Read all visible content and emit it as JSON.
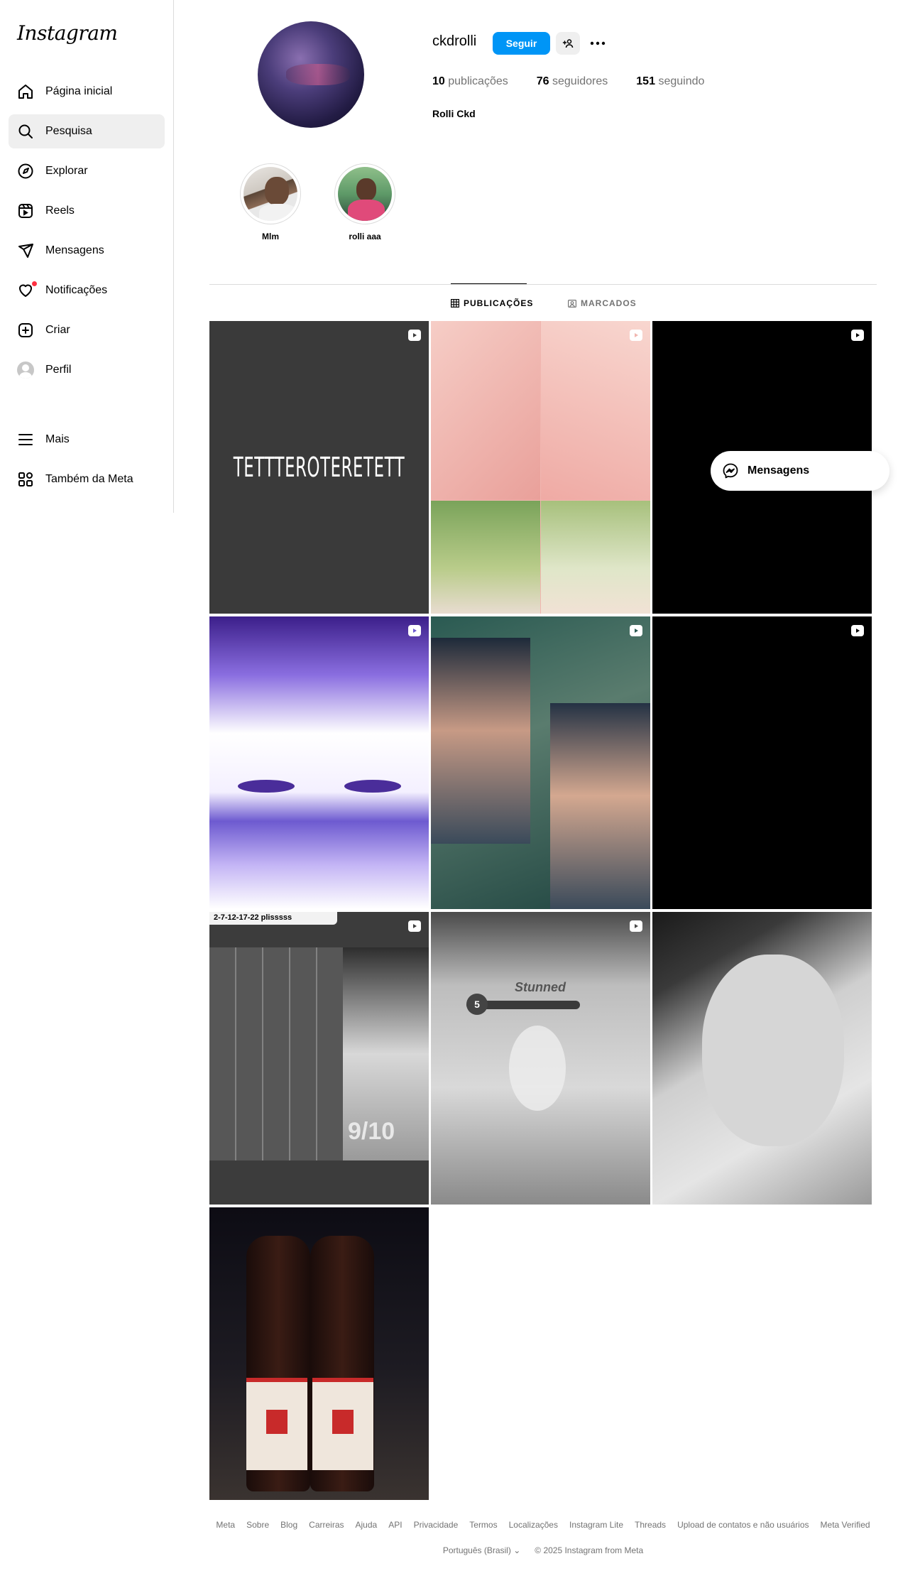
{
  "app": {
    "logo": "Instagram"
  },
  "sidebar": {
    "items": [
      {
        "label": "Página inicial",
        "icon": "home-icon"
      },
      {
        "label": "Pesquisa",
        "icon": "search-icon",
        "active": true
      },
      {
        "label": "Explorar",
        "icon": "compass-icon"
      },
      {
        "label": "Reels",
        "icon": "reels-icon"
      },
      {
        "label": "Mensagens",
        "icon": "send-icon"
      },
      {
        "label": "Notificações",
        "icon": "heart-icon",
        "badge": true
      },
      {
        "label": "Criar",
        "icon": "plus-square-icon"
      },
      {
        "label": "Perfil",
        "icon": "avatar"
      }
    ],
    "more": [
      {
        "label": "Mais",
        "icon": "menu-icon"
      },
      {
        "label": "Também da Meta",
        "icon": "grid-icon"
      }
    ]
  },
  "profile": {
    "username": "ckdrolli",
    "follow_label": "Seguir",
    "stats": {
      "posts_count": "10",
      "posts_label": "publicações",
      "followers_count": "76",
      "followers_label": "seguidores",
      "following_count": "151",
      "following_label": "seguindo"
    },
    "full_name": "Rolli Ckd"
  },
  "highlights": [
    {
      "label": "Mlm"
    },
    {
      "label": "rolli aaa"
    }
  ],
  "tabs": [
    {
      "label": "PUBLICAÇÕES",
      "icon": "grid-icon",
      "active": true
    },
    {
      "label": "MARCADOS",
      "icon": "tag-icon",
      "active": false
    }
  ],
  "posts": [
    {
      "type": "reel",
      "text": "TETTTEROTERETETT",
      "bg": "#3a3a3a"
    },
    {
      "type": "reel",
      "bg": "#f1b6b0"
    },
    {
      "type": "reel",
      "bg": "#000000"
    },
    {
      "type": "reel",
      "bg": "#e8dcff"
    },
    {
      "type": "reel",
      "bg": "#2e5a52"
    },
    {
      "type": "reel",
      "bg": "#000000"
    },
    {
      "type": "reel",
      "text": "2-7-12-17-22 plisssss",
      "overlay": "9/10",
      "bg": "#3c3c3c"
    },
    {
      "type": "reel",
      "overlay": "Stunned",
      "badge": "5",
      "bg": "#6d6d6d"
    },
    {
      "type": "photo",
      "bg": "#8a8a8a"
    },
    {
      "type": "photo",
      "bg": "#1d1b1c"
    }
  ],
  "messages_pill": {
    "label": "Mensagens"
  },
  "footer": {
    "links": [
      "Meta",
      "Sobre",
      "Blog",
      "Carreiras",
      "Ajuda",
      "API",
      "Privacidade",
      "Termos",
      "Localizações",
      "Instagram Lite",
      "Threads",
      "Upload de contatos e não usuários",
      "Meta Verified"
    ],
    "language": "Português (Brasil)",
    "copyright": "© 2025 Instagram from Meta"
  },
  "colors": {
    "accent": "#0095f6",
    "notification": "#ff3040"
  }
}
